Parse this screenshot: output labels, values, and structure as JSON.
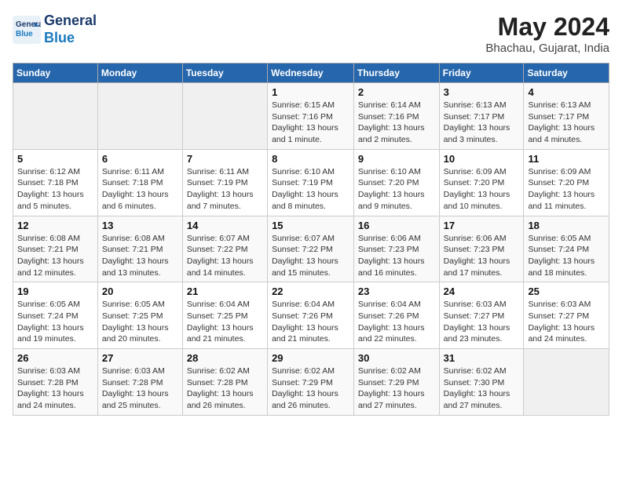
{
  "header": {
    "logo_line1": "General",
    "logo_line2": "Blue",
    "month": "May 2024",
    "location": "Bhachau, Gujarat, India"
  },
  "weekdays": [
    "Sunday",
    "Monday",
    "Tuesday",
    "Wednesday",
    "Thursday",
    "Friday",
    "Saturday"
  ],
  "weeks": [
    [
      {
        "day": "",
        "info": ""
      },
      {
        "day": "",
        "info": ""
      },
      {
        "day": "",
        "info": ""
      },
      {
        "day": "1",
        "info": "Sunrise: 6:15 AM\nSunset: 7:16 PM\nDaylight: 13 hours\nand 1 minute."
      },
      {
        "day": "2",
        "info": "Sunrise: 6:14 AM\nSunset: 7:16 PM\nDaylight: 13 hours\nand 2 minutes."
      },
      {
        "day": "3",
        "info": "Sunrise: 6:13 AM\nSunset: 7:17 PM\nDaylight: 13 hours\nand 3 minutes."
      },
      {
        "day": "4",
        "info": "Sunrise: 6:13 AM\nSunset: 7:17 PM\nDaylight: 13 hours\nand 4 minutes."
      }
    ],
    [
      {
        "day": "5",
        "info": "Sunrise: 6:12 AM\nSunset: 7:18 PM\nDaylight: 13 hours\nand 5 minutes."
      },
      {
        "day": "6",
        "info": "Sunrise: 6:11 AM\nSunset: 7:18 PM\nDaylight: 13 hours\nand 6 minutes."
      },
      {
        "day": "7",
        "info": "Sunrise: 6:11 AM\nSunset: 7:19 PM\nDaylight: 13 hours\nand 7 minutes."
      },
      {
        "day": "8",
        "info": "Sunrise: 6:10 AM\nSunset: 7:19 PM\nDaylight: 13 hours\nand 8 minutes."
      },
      {
        "day": "9",
        "info": "Sunrise: 6:10 AM\nSunset: 7:20 PM\nDaylight: 13 hours\nand 9 minutes."
      },
      {
        "day": "10",
        "info": "Sunrise: 6:09 AM\nSunset: 7:20 PM\nDaylight: 13 hours\nand 10 minutes."
      },
      {
        "day": "11",
        "info": "Sunrise: 6:09 AM\nSunset: 7:20 PM\nDaylight: 13 hours\nand 11 minutes."
      }
    ],
    [
      {
        "day": "12",
        "info": "Sunrise: 6:08 AM\nSunset: 7:21 PM\nDaylight: 13 hours\nand 12 minutes."
      },
      {
        "day": "13",
        "info": "Sunrise: 6:08 AM\nSunset: 7:21 PM\nDaylight: 13 hours\nand 13 minutes."
      },
      {
        "day": "14",
        "info": "Sunrise: 6:07 AM\nSunset: 7:22 PM\nDaylight: 13 hours\nand 14 minutes."
      },
      {
        "day": "15",
        "info": "Sunrise: 6:07 AM\nSunset: 7:22 PM\nDaylight: 13 hours\nand 15 minutes."
      },
      {
        "day": "16",
        "info": "Sunrise: 6:06 AM\nSunset: 7:23 PM\nDaylight: 13 hours\nand 16 minutes."
      },
      {
        "day": "17",
        "info": "Sunrise: 6:06 AM\nSunset: 7:23 PM\nDaylight: 13 hours\nand 17 minutes."
      },
      {
        "day": "18",
        "info": "Sunrise: 6:05 AM\nSunset: 7:24 PM\nDaylight: 13 hours\nand 18 minutes."
      }
    ],
    [
      {
        "day": "19",
        "info": "Sunrise: 6:05 AM\nSunset: 7:24 PM\nDaylight: 13 hours\nand 19 minutes."
      },
      {
        "day": "20",
        "info": "Sunrise: 6:05 AM\nSunset: 7:25 PM\nDaylight: 13 hours\nand 20 minutes."
      },
      {
        "day": "21",
        "info": "Sunrise: 6:04 AM\nSunset: 7:25 PM\nDaylight: 13 hours\nand 21 minutes."
      },
      {
        "day": "22",
        "info": "Sunrise: 6:04 AM\nSunset: 7:26 PM\nDaylight: 13 hours\nand 21 minutes."
      },
      {
        "day": "23",
        "info": "Sunrise: 6:04 AM\nSunset: 7:26 PM\nDaylight: 13 hours\nand 22 minutes."
      },
      {
        "day": "24",
        "info": "Sunrise: 6:03 AM\nSunset: 7:27 PM\nDaylight: 13 hours\nand 23 minutes."
      },
      {
        "day": "25",
        "info": "Sunrise: 6:03 AM\nSunset: 7:27 PM\nDaylight: 13 hours\nand 24 minutes."
      }
    ],
    [
      {
        "day": "26",
        "info": "Sunrise: 6:03 AM\nSunset: 7:28 PM\nDaylight: 13 hours\nand 24 minutes."
      },
      {
        "day": "27",
        "info": "Sunrise: 6:03 AM\nSunset: 7:28 PM\nDaylight: 13 hours\nand 25 minutes."
      },
      {
        "day": "28",
        "info": "Sunrise: 6:02 AM\nSunset: 7:28 PM\nDaylight: 13 hours\nand 26 minutes."
      },
      {
        "day": "29",
        "info": "Sunrise: 6:02 AM\nSunset: 7:29 PM\nDaylight: 13 hours\nand 26 minutes."
      },
      {
        "day": "30",
        "info": "Sunrise: 6:02 AM\nSunset: 7:29 PM\nDaylight: 13 hours\nand 27 minutes."
      },
      {
        "day": "31",
        "info": "Sunrise: 6:02 AM\nSunset: 7:30 PM\nDaylight: 13 hours\nand 27 minutes."
      },
      {
        "day": "",
        "info": ""
      }
    ]
  ]
}
